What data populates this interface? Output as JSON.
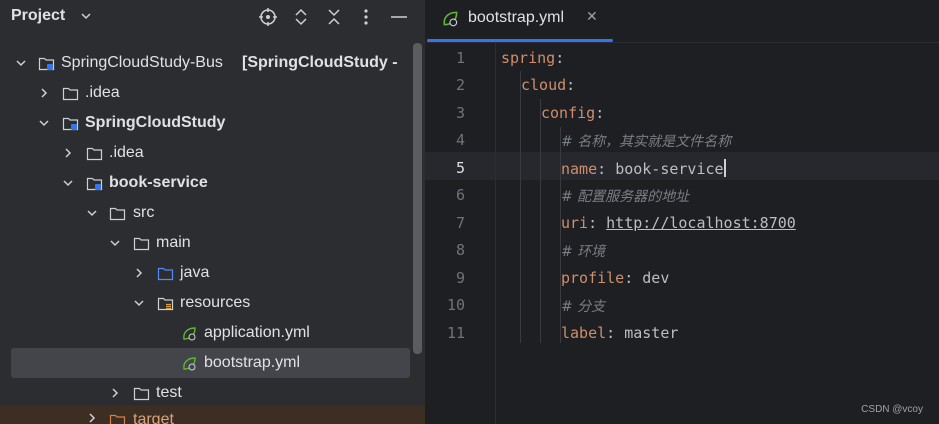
{
  "project_panel": {
    "title": "Project",
    "tree": [
      {
        "label": "SpringCloudStudy-Bus",
        "suffix": "[SpringCloudStudy - ",
        "bold": false
      },
      {
        "label": ".idea"
      },
      {
        "label": "SpringCloudStudy"
      },
      {
        "label": ".idea"
      },
      {
        "label": "book-service"
      },
      {
        "label": "src"
      },
      {
        "label": "main"
      },
      {
        "label": "java"
      },
      {
        "label": "resources"
      },
      {
        "label": "application.yml"
      },
      {
        "label": "bootstrap.yml"
      },
      {
        "label": "test"
      },
      {
        "label": "target"
      }
    ]
  },
  "editor": {
    "tab": {
      "label": "bootstrap.yml",
      "close": "✕"
    },
    "line_numbers": [
      "1",
      "2",
      "3",
      "4",
      "5",
      "6",
      "7",
      "8",
      "9",
      "10",
      "11"
    ],
    "lines": [
      {
        "key": "spring",
        "sep": ":"
      },
      {
        "key": "cloud",
        "sep": ":"
      },
      {
        "key": "config",
        "sep": ":"
      },
      {
        "comment": "# 名称，其实就是文件名称"
      },
      {
        "key": "name",
        "sep": ": ",
        "value": "book-service"
      },
      {
        "comment": "# 配置服务器的地址"
      },
      {
        "key": "uri",
        "sep": ": ",
        "url": "http://localhost:8700"
      },
      {
        "comment": "# 环境"
      },
      {
        "key": "profile",
        "sep": ": ",
        "value": "dev"
      },
      {
        "comment": "# 分支"
      },
      {
        "key": "label",
        "sep": ": ",
        "value": "master"
      }
    ],
    "active_line": "5"
  },
  "watermark": "CSDN @vcoy",
  "colors": {
    "accent": "#3574f0",
    "keyword": "#cf8e6d",
    "comment": "#7a7e85",
    "panel": "#2b2d30",
    "editor": "#1e1f22"
  }
}
